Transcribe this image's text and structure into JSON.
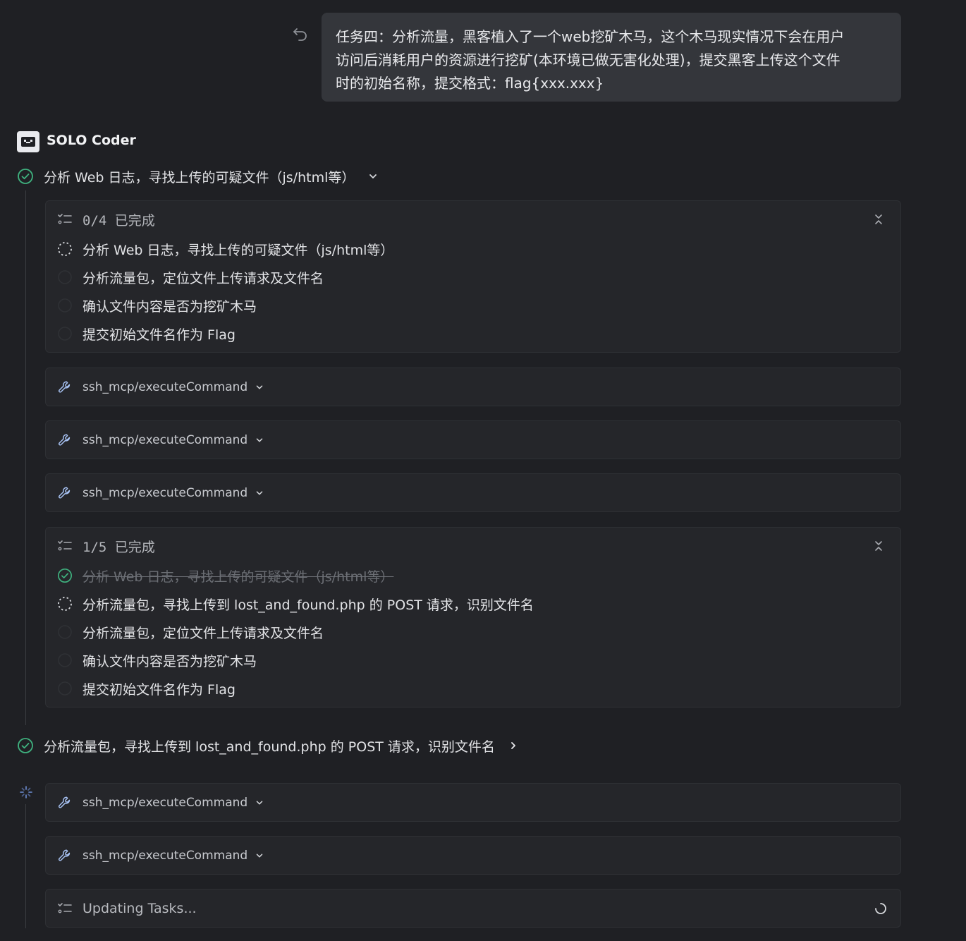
{
  "user_message": {
    "lines": [
      "任务四：分析流量，黑客植入了一个web挖矿木马，这个木马现实情况下会在用户",
      "访问后消耗用户的资源进行挖矿(本环境已做无害化处理)，提交黑客上传这个文件",
      "时的初始名称，提交格式：flag{xxx.xxx}"
    ]
  },
  "agent": {
    "name": "SOLO Coder"
  },
  "step1": {
    "title": "分析 Web 日志，寻找上传的可疑文件（js/html等）"
  },
  "todo1": {
    "count": "0/4 已完成",
    "items": [
      "分析 Web 日志，寻找上传的可疑文件（js/html等）",
      "分析流量包，定位文件上传请求及文件名",
      "确认文件内容是否为挖矿木马",
      "提交初始文件名作为 Flag"
    ]
  },
  "tools": {
    "label": "ssh_mcp/executeCommand"
  },
  "todo2": {
    "count": "1/5 已完成",
    "items": [
      "分析 Web 日志，寻找上传的可疑文件（js/html等）",
      "分析流量包，寻找上传到 lost_and_found.php 的 POST 请求，识别文件名",
      "分析流量包，定位文件上传请求及文件名",
      "确认文件内容是否为挖矿木马",
      "提交初始文件名作为 Flag"
    ]
  },
  "step2": {
    "title": "分析流量包，寻找上传到 lost_and_found.php 的 POST 请求，识别文件名"
  },
  "updating": {
    "label": "Updating Tasks..."
  },
  "colors": {
    "success": "#3fb27f",
    "accent": "#e9eaee"
  }
}
